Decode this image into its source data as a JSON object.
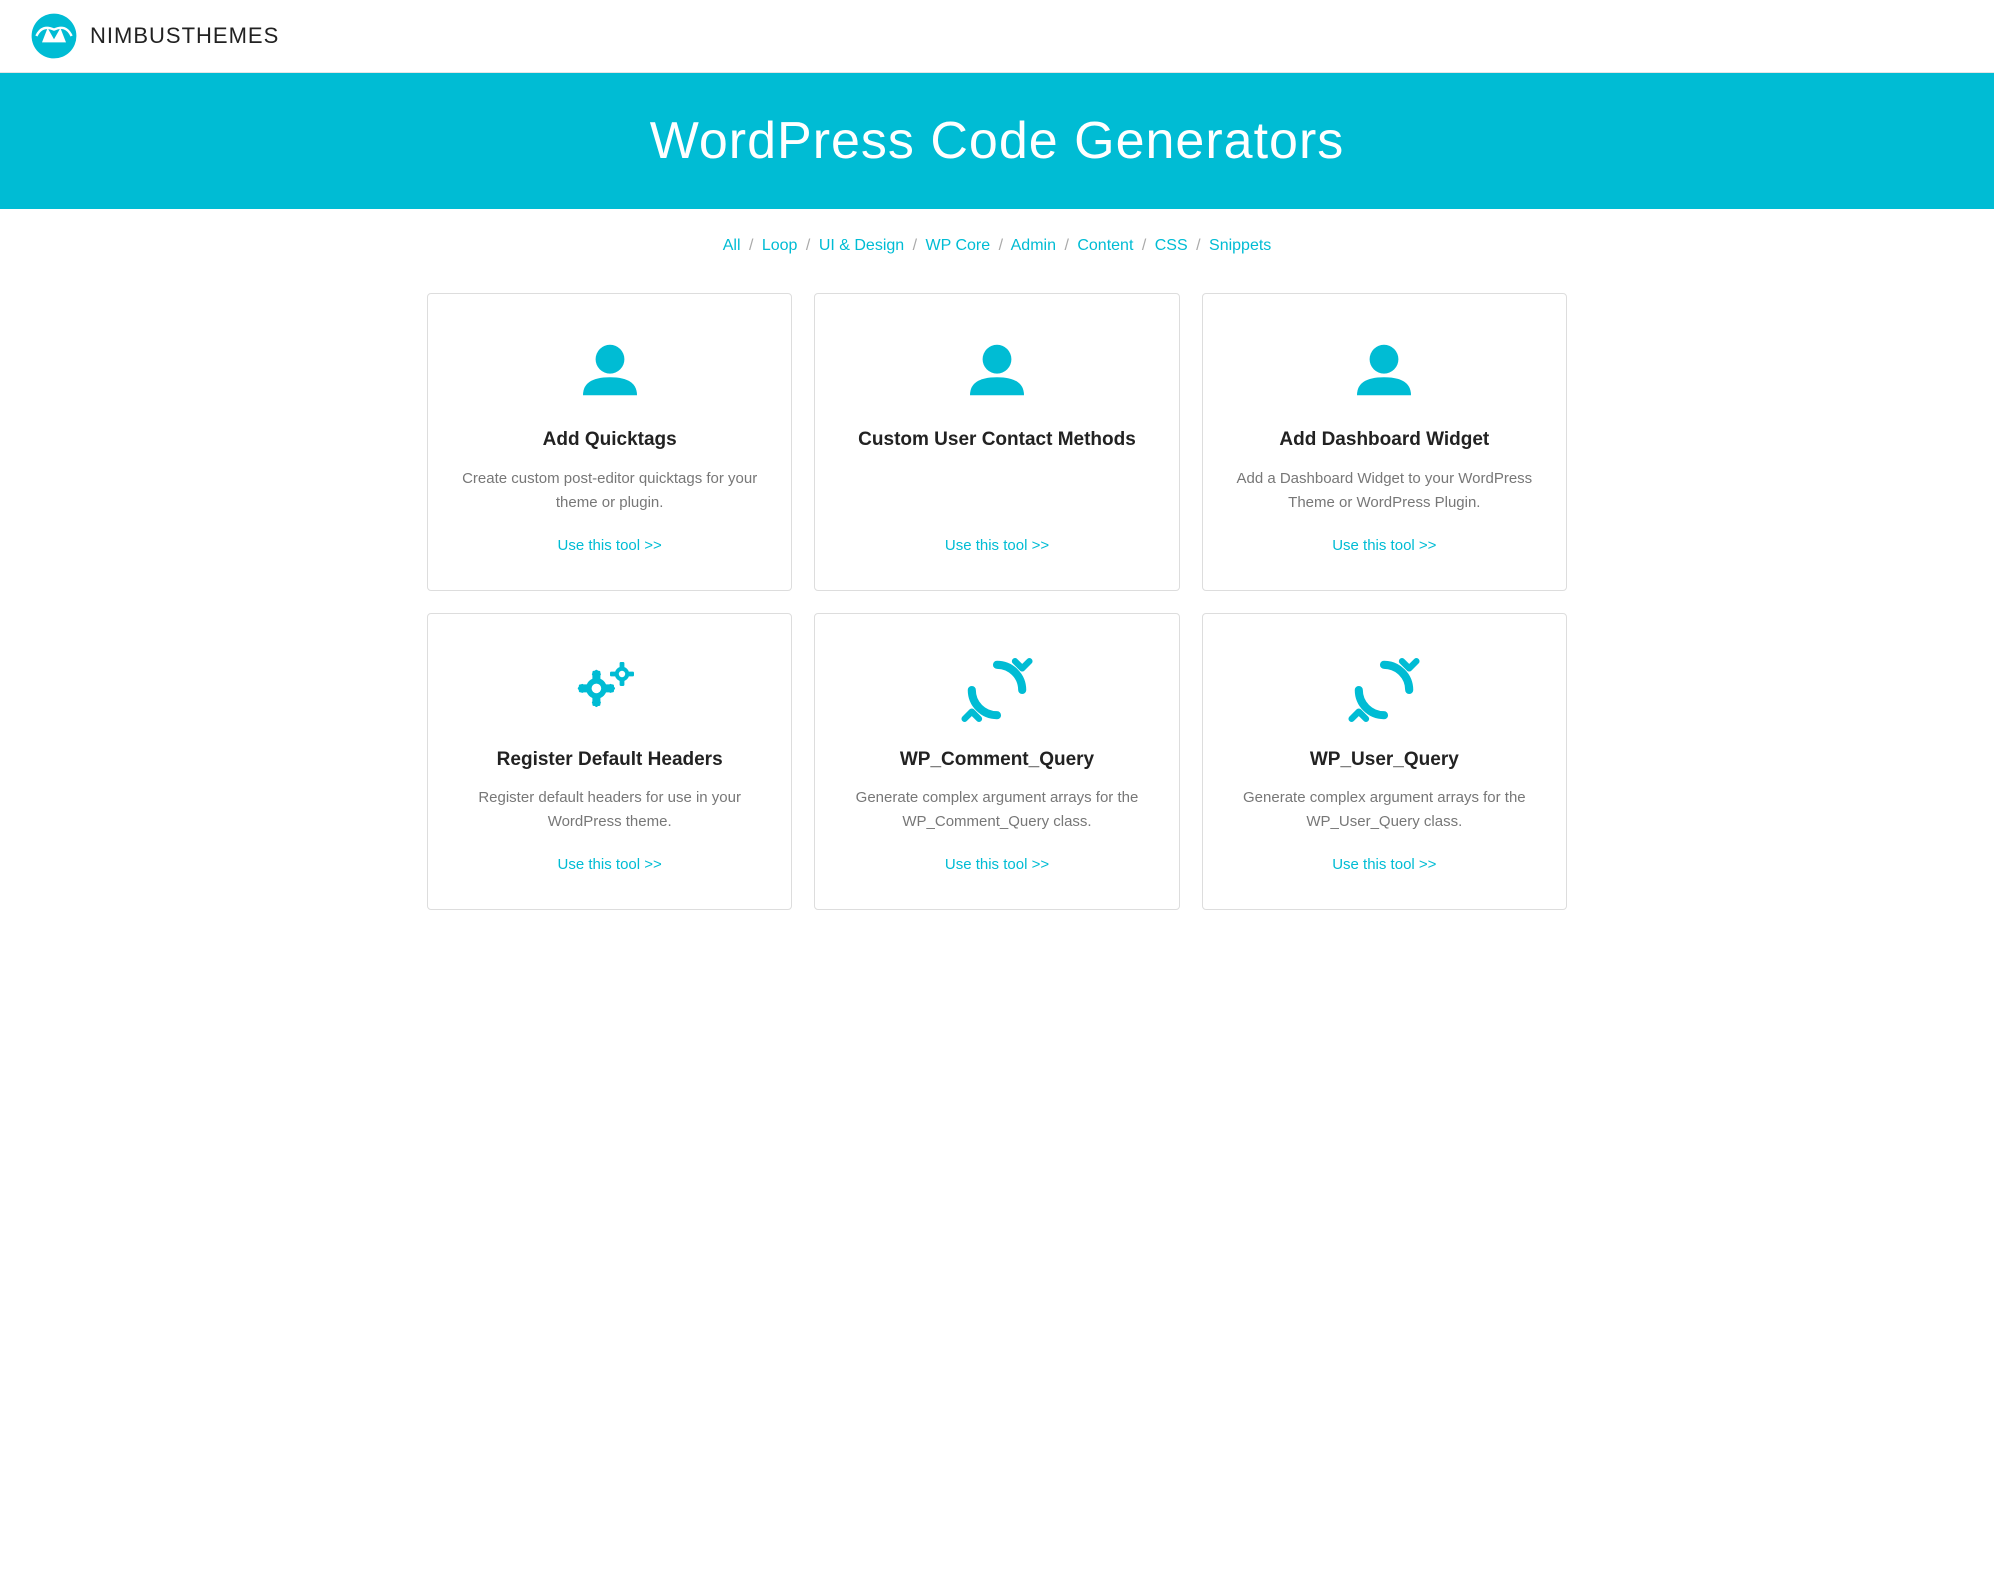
{
  "header": {
    "logo_text_bold": "NIMBUS",
    "logo_text_light": "THEMES"
  },
  "hero": {
    "title": "WordPress Code Generators"
  },
  "filter_nav": {
    "items": [
      {
        "label": "All",
        "active": true
      },
      {
        "label": "Loop",
        "active": false
      },
      {
        "label": "UI & Design",
        "active": false
      },
      {
        "label": "WP Core",
        "active": false
      },
      {
        "label": "Admin",
        "active": false
      },
      {
        "label": "Content",
        "active": false
      },
      {
        "label": "CSS",
        "active": false
      },
      {
        "label": "Snippets",
        "active": false
      }
    ],
    "separator": "/"
  },
  "cards": [
    {
      "id": "add-quicktags",
      "icon": "user",
      "title": "Add Quicktags",
      "description": "Create custom post-editor quicktags for your theme or plugin.",
      "link_label": "Use this tool >>"
    },
    {
      "id": "custom-user-contact",
      "icon": "user",
      "title": "Custom User Contact Methods",
      "description": "",
      "link_label": "Use this tool >>"
    },
    {
      "id": "add-dashboard-widget",
      "icon": "user",
      "title": "Add Dashboard Widget",
      "description": "Add a Dashboard Widget to your WordPress Theme or WordPress Plugin.",
      "link_label": "Use this tool >>"
    },
    {
      "id": "register-default-headers",
      "icon": "gears",
      "title": "Register Default Headers",
      "description": "Register default headers for use in your WordPress theme.",
      "link_label": "Use this tool >>"
    },
    {
      "id": "wp-comment-query",
      "icon": "refresh",
      "title": "WP_Comment_Query",
      "description": "Generate complex argument arrays for the WP_Comment_Query class.",
      "link_label": "Use this tool >>"
    },
    {
      "id": "wp-user-query",
      "icon": "refresh",
      "title": "WP_User_Query",
      "description": "Generate complex argument arrays for the WP_User_Query class.",
      "link_label": "Use this tool >>"
    }
  ]
}
